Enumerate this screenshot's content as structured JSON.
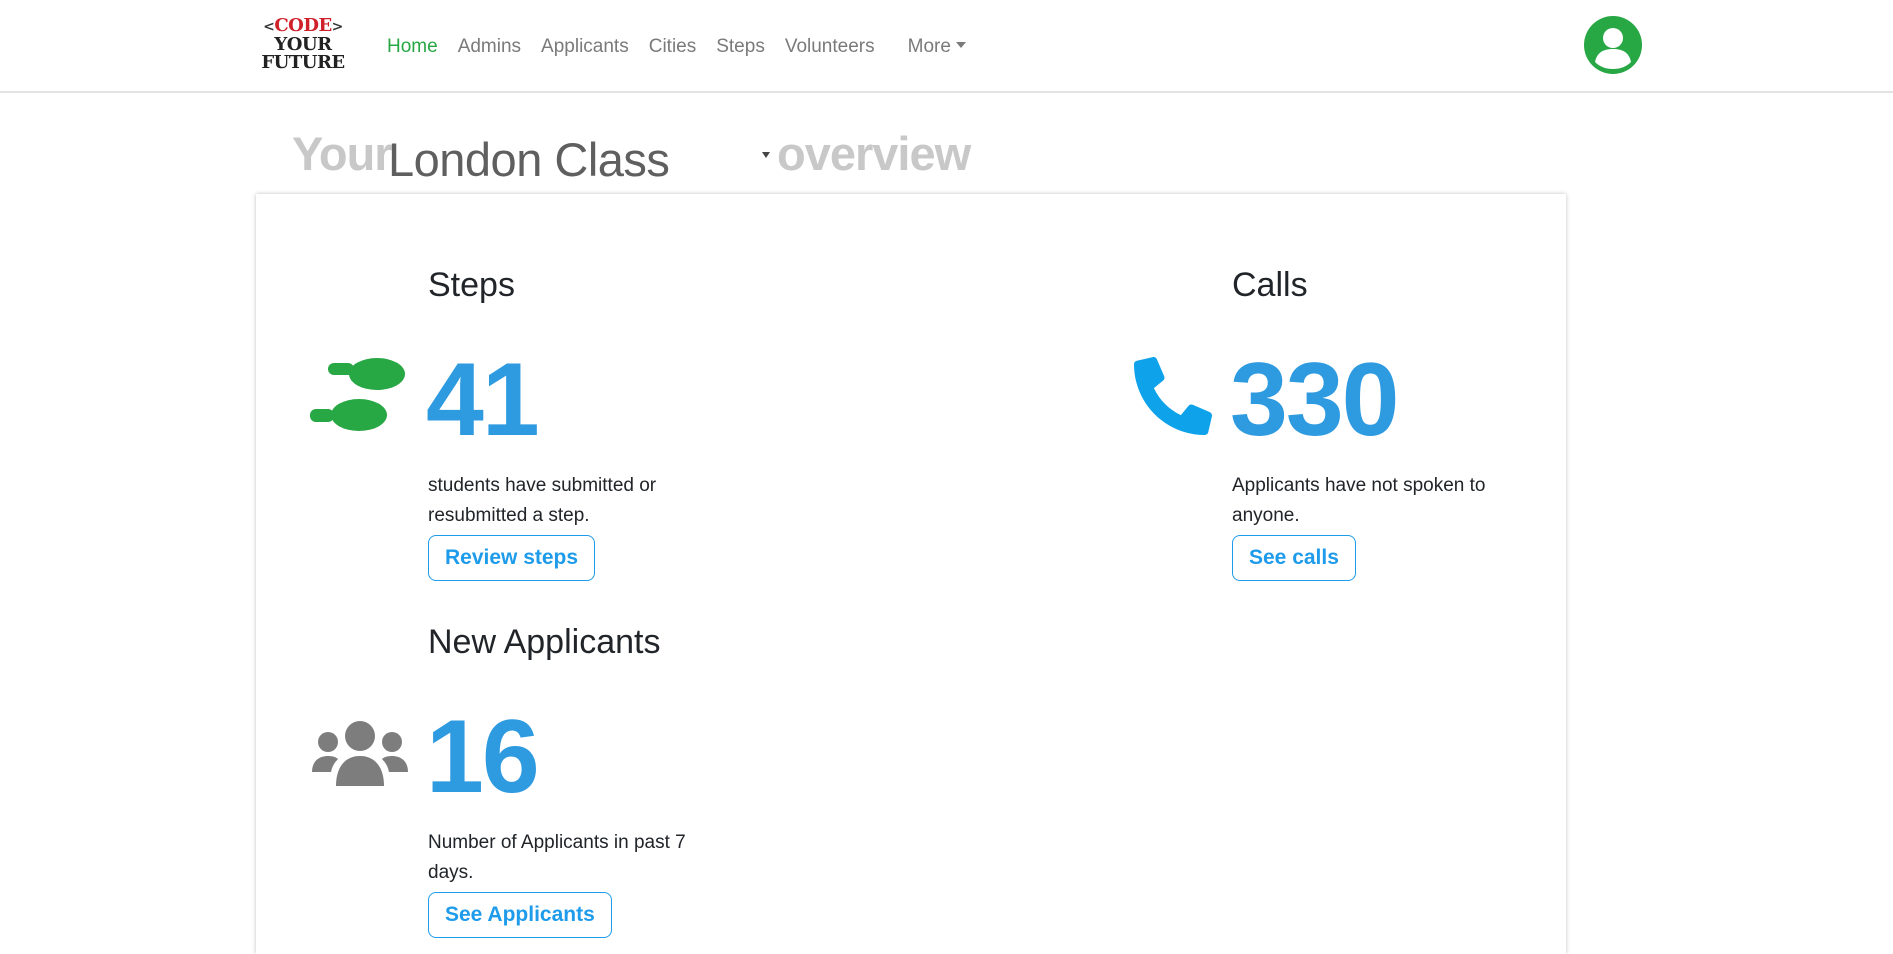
{
  "brand": {
    "logo_line1_code": "CODE",
    "logo_bracket_open": "<",
    "logo_bracket_close": ">",
    "logo_line2": "YOUR",
    "logo_line3": "FUTURE"
  },
  "nav": {
    "items": [
      {
        "label": "Home",
        "active": true
      },
      {
        "label": "Admins"
      },
      {
        "label": "Applicants"
      },
      {
        "label": "Cities"
      },
      {
        "label": "Steps"
      },
      {
        "label": "Volunteers"
      }
    ],
    "more_label": "More"
  },
  "user": {
    "icon": "user-avatar-icon",
    "color": "#28a745"
  },
  "heading": {
    "prefix": "Your",
    "class_select_value": "London Class",
    "suffix": "overview"
  },
  "colors": {
    "accent_green": "#28a745",
    "number_blue": "#2e9ae0",
    "button_blue": "#1e9bea",
    "phone_blue": "#0ea2ea",
    "group_gray": "#7d7d7d"
  },
  "stats": {
    "steps": {
      "title": "Steps",
      "icon": "footsteps-icon",
      "value": "41",
      "description": "students have submitted or resubmitted a step.",
      "button": "Review steps"
    },
    "calls": {
      "title": "Calls",
      "icon": "phone-icon",
      "value": "330",
      "description": "Applicants have not spoken to anyone.",
      "button": "See calls"
    },
    "applicants": {
      "title": "New Applicants",
      "icon": "users-group-icon",
      "value": "16",
      "description": "Number of Applicants in past 7 days.",
      "button": "See Applicants"
    }
  }
}
